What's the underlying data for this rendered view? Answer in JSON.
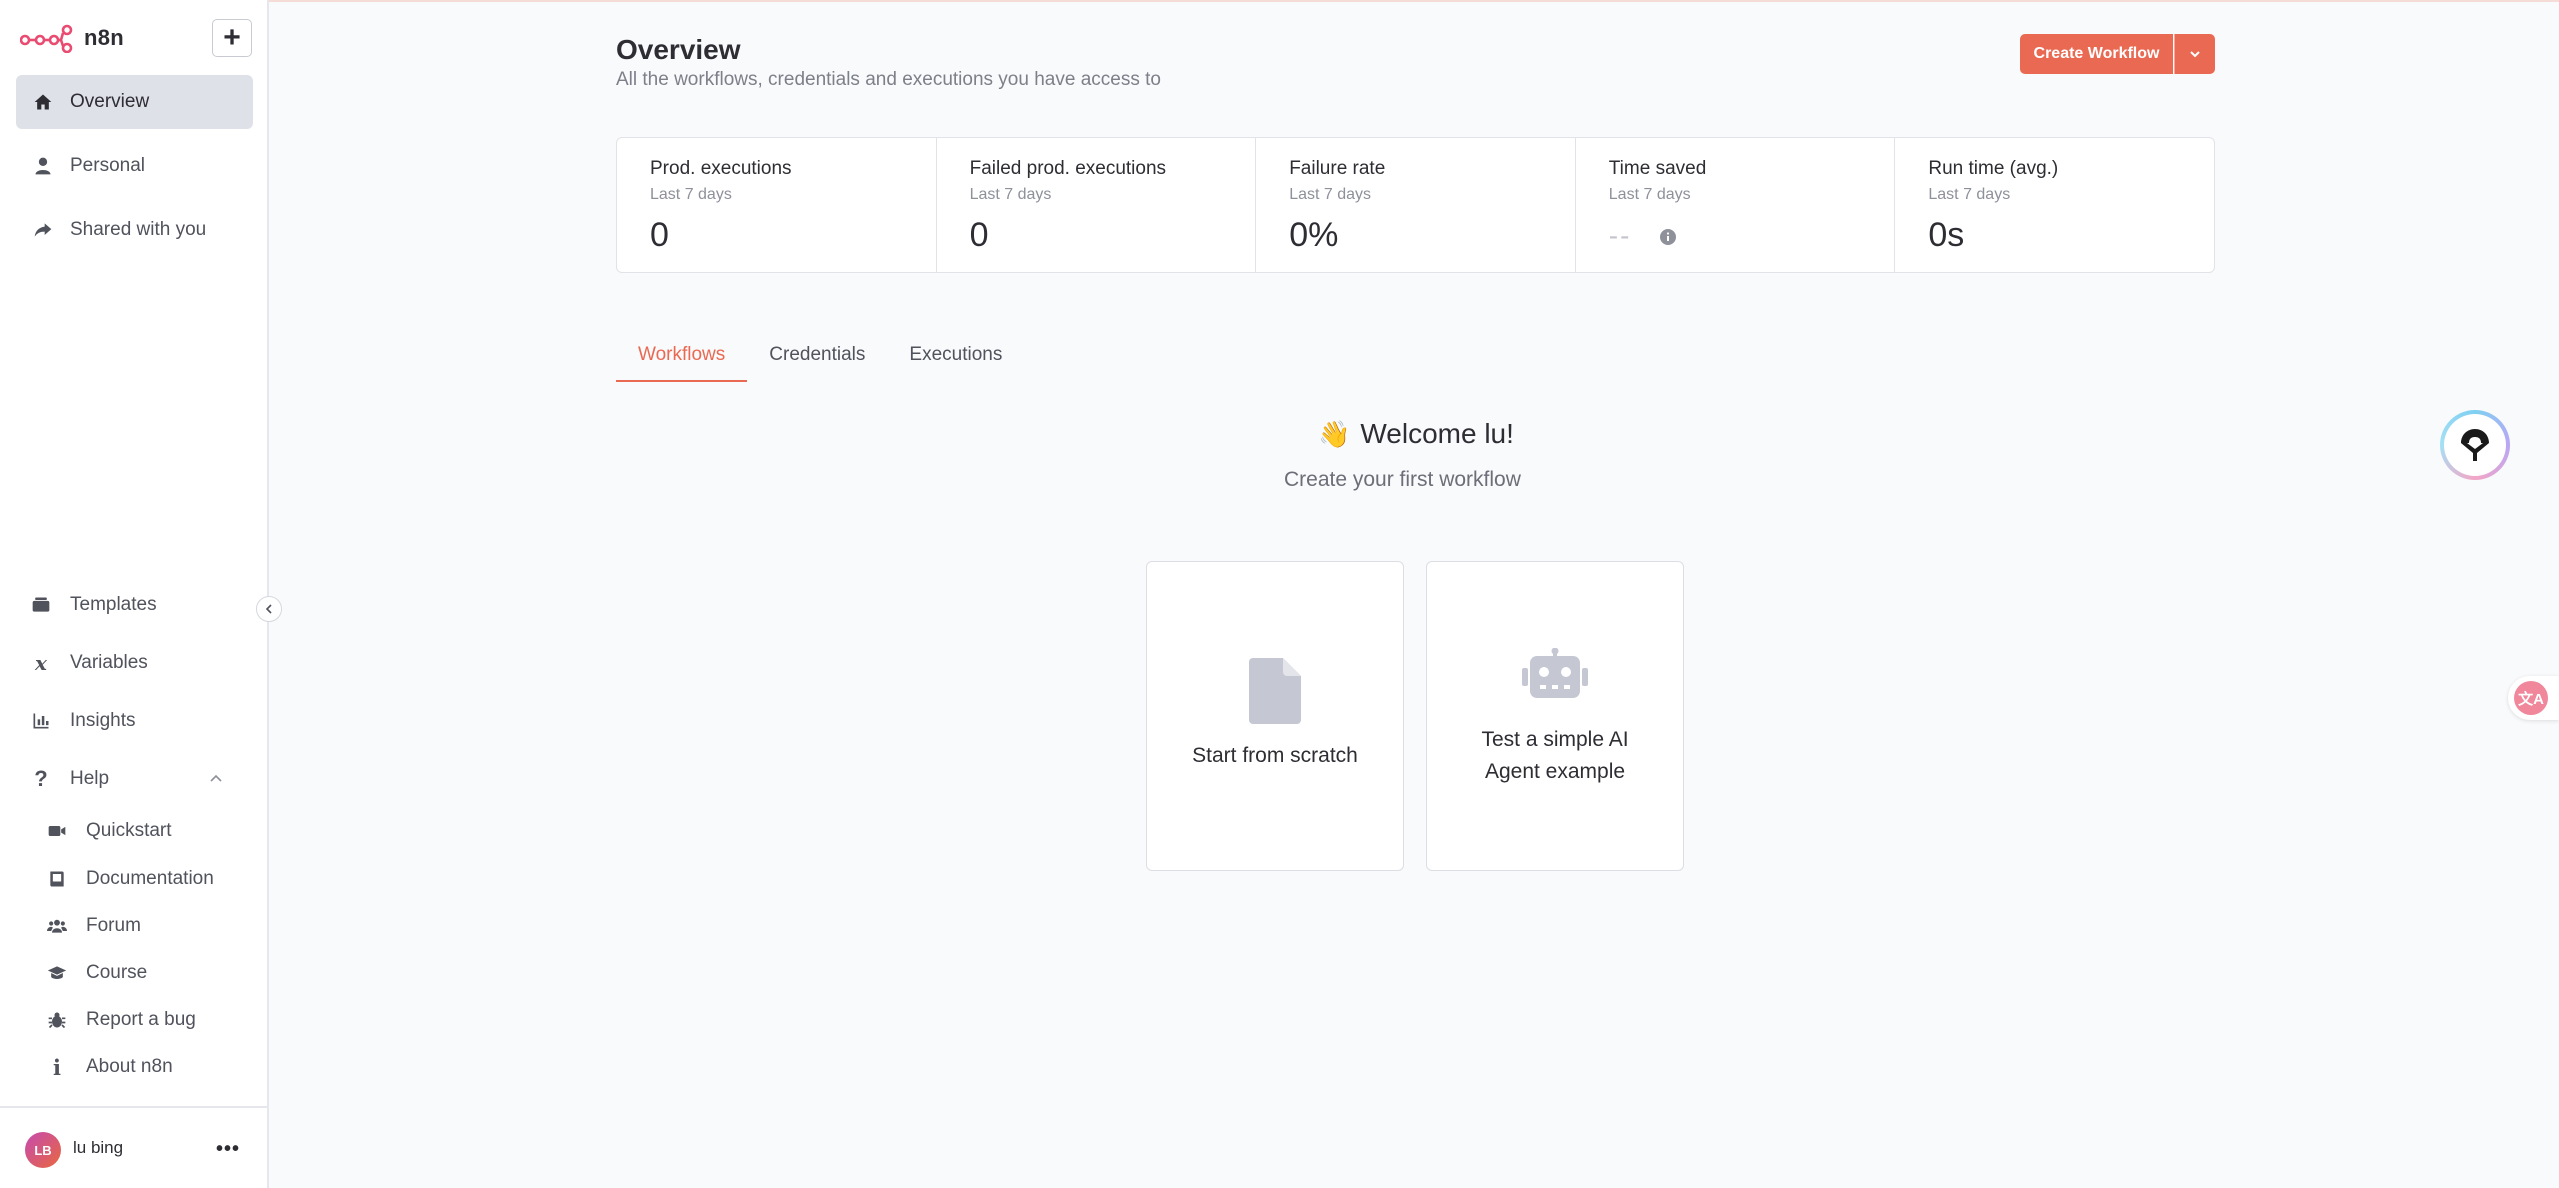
{
  "app": {
    "name": "n8n",
    "brand_color": "#ea6952"
  },
  "sidebar": {
    "nav": [
      {
        "label": "Overview",
        "icon": "home-icon",
        "active": true
      },
      {
        "label": "Personal",
        "icon": "user-icon"
      },
      {
        "label": "Shared with you",
        "icon": "share-icon"
      }
    ],
    "lower": [
      {
        "label": "Templates",
        "icon": "templates-icon"
      },
      {
        "label": "Variables",
        "icon": "variable-icon"
      },
      {
        "label": "Insights",
        "icon": "chart-icon"
      },
      {
        "label": "Help",
        "icon": "question-icon"
      }
    ],
    "help_items": [
      {
        "label": "Quickstart",
        "icon": "video-icon"
      },
      {
        "label": "Documentation",
        "icon": "book-icon"
      },
      {
        "label": "Forum",
        "icon": "users-icon"
      },
      {
        "label": "Course",
        "icon": "graduation-cap-icon"
      },
      {
        "label": "Report a bug",
        "icon": "bug-icon"
      },
      {
        "label": "About n8n",
        "icon": "info-icon"
      }
    ],
    "user": {
      "initials": "LB",
      "name": "lu bing",
      "more": "•••"
    },
    "add_label": "+"
  },
  "header": {
    "title": "Overview",
    "subtitle": "All the workflows, credentials and executions you have access to",
    "create_button": "Create Workflow"
  },
  "stats": [
    {
      "label": "Prod. executions",
      "period": "Last 7 days",
      "value": "0"
    },
    {
      "label": "Failed prod. executions",
      "period": "Last 7 days",
      "value": "0"
    },
    {
      "label": "Failure rate",
      "period": "Last 7 days",
      "value": "0%"
    },
    {
      "label": "Time saved",
      "period": "Last 7 days",
      "value": "--"
    },
    {
      "label": "Run time (avg.)",
      "period": "Last 7 days",
      "value": "0s"
    }
  ],
  "tabs": [
    {
      "label": "Workflows",
      "active": true
    },
    {
      "label": "Credentials"
    },
    {
      "label": "Executions"
    }
  ],
  "welcome": {
    "emoji": "👋",
    "title": "Welcome lu!",
    "subtitle": "Create your first workflow"
  },
  "cards": [
    {
      "label": "Start from scratch",
      "icon": "file-icon"
    },
    {
      "label_line1": "Test a simple AI",
      "label_line2": "Agent example",
      "icon": "robot-icon"
    }
  ],
  "translate_badge": "文A"
}
